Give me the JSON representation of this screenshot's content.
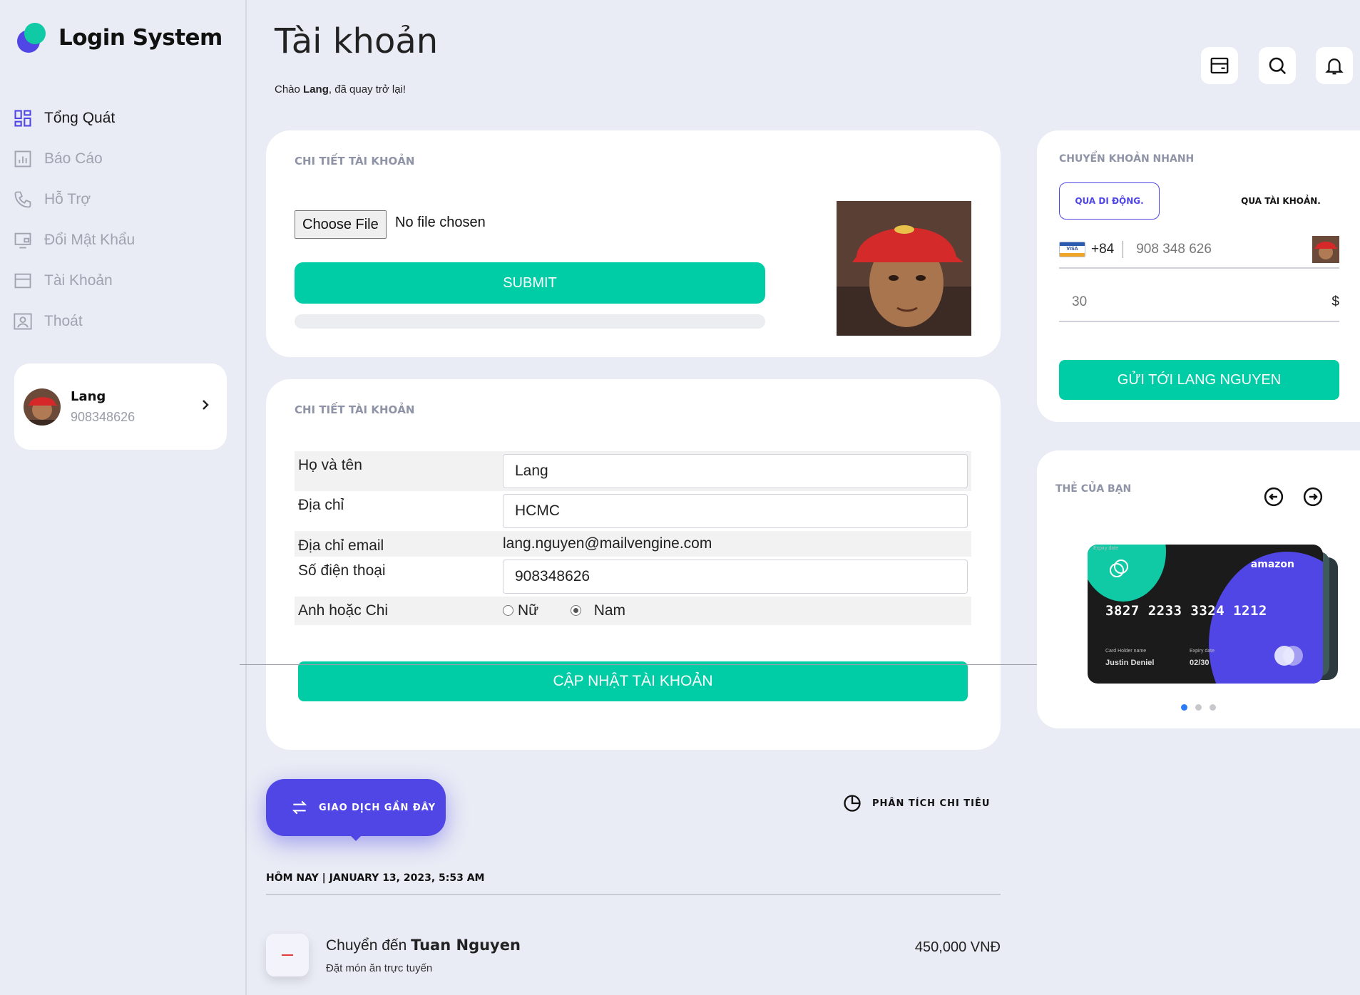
{
  "app": {
    "title": "Login System"
  },
  "sidebar": {
    "items": [
      {
        "label": "Tổng Quát",
        "icon": "dashboard-icon",
        "active": true
      },
      {
        "label": "Báo Cáo",
        "icon": "report-icon",
        "active": false
      },
      {
        "label": "Hỗ Trợ",
        "icon": "phone-icon",
        "active": false
      },
      {
        "label": "Đổi Mật Khẩu",
        "icon": "password-icon",
        "active": false
      },
      {
        "label": "Tài Khoản",
        "icon": "account-icon",
        "active": false
      },
      {
        "label": "Thoát",
        "icon": "logout-icon",
        "active": false
      }
    ],
    "profile": {
      "name": "Lang",
      "phone": "908348626"
    }
  },
  "header": {
    "title": "Tài khoản",
    "greeting_prefix": "Chào ",
    "greeting_name": "Lang",
    "greeting_suffix": ", đã quay trở lại!",
    "icons": [
      "wallet-icon",
      "search-icon",
      "bell-icon"
    ]
  },
  "upload_card": {
    "title": "CHI TIẾT TÀI KHOẢN",
    "choose_file_label": "Choose File",
    "no_file_text": "No file chosen",
    "submit_label": "SUBMIT",
    "progress": 0
  },
  "form_card": {
    "title": "CHI TIẾT TÀI KHOẢN",
    "fields": {
      "name_label": "Họ và tên",
      "name_value": "Lang",
      "address_label": "Địa chỉ",
      "address_value": "HCMC",
      "email_label": "Địa chỉ email",
      "email_value": "lang.nguyen@mailvengine.com",
      "phone_label": "Số điện thoại",
      "phone_value": "908348626",
      "gender_label": "Anh hoặc Chi",
      "gender_female": "Nữ",
      "gender_male": "Nam"
    },
    "selected_gender": "Nam",
    "update_label": "CẬP NHẬT TÀI KHOẢN"
  },
  "transactions": {
    "recent_label": "GIAO DỊCH GẦN ĐÂY",
    "analysis_label": "PHÂN TÍCH CHI TIÊU",
    "date_header": "HÔM NAY | JANUARY 13, 2023, 5:53 AM",
    "items": [
      {
        "prefix": "Chuyển đến ",
        "recipient": "Tuan Nguyen",
        "description": "Đặt món ăn trực tuyến",
        "amount": "450,000 VNĐ"
      }
    ]
  },
  "quick_transfer": {
    "title": "CHUYỂN KHOẢN NHANH",
    "tab_mobile": "QUA DI ĐỘNG.",
    "tab_account": "QUA TÀI KHOẢN.",
    "card_brand_icon": "VISA",
    "country_code": "+84",
    "phone": "908 348 626",
    "amount": "30",
    "currency": "$",
    "send_label": "GỬI TỚI LANG NGUYEN"
  },
  "cards": {
    "title": "THẺ CỦA BẠN",
    "card": {
      "brand": "amazon",
      "number": "3827 2233 3324 1212",
      "holder_caption": "Card Holder name",
      "holder": "Justin Deniel",
      "expiry_caption": "Expiry date",
      "expiry": "02/30",
      "corner_caption": "Expiry date"
    },
    "active_dot": 0,
    "dot_count": 3
  },
  "colors": {
    "accent": "#00cca6",
    "brand": "#4f46e5",
    "background": "#e9ebf5"
  }
}
